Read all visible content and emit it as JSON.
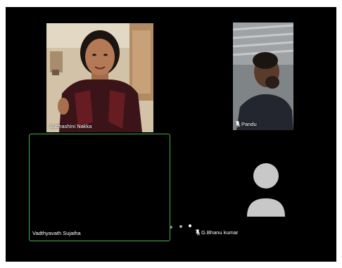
{
  "participants": [
    {
      "name": "Subhashini Nakka",
      "has_video": true,
      "muted": false
    },
    {
      "name": "Pandu",
      "has_video": true,
      "muted": true
    },
    {
      "name": "Vadthyavath Sujatha",
      "has_video": false,
      "active_speaker": true
    },
    {
      "name": "G.Bhanu kumar",
      "has_video": false,
      "muted": true
    }
  ],
  "colors": {
    "background": "#000000",
    "active_speaker_border": "#4caf50",
    "avatar": "#c8c8c8",
    "name_text": "#ffffff"
  },
  "icons": {
    "mute": "mic-off-icon",
    "avatar": "person-avatar-icon",
    "more": "more-dots-icon"
  }
}
